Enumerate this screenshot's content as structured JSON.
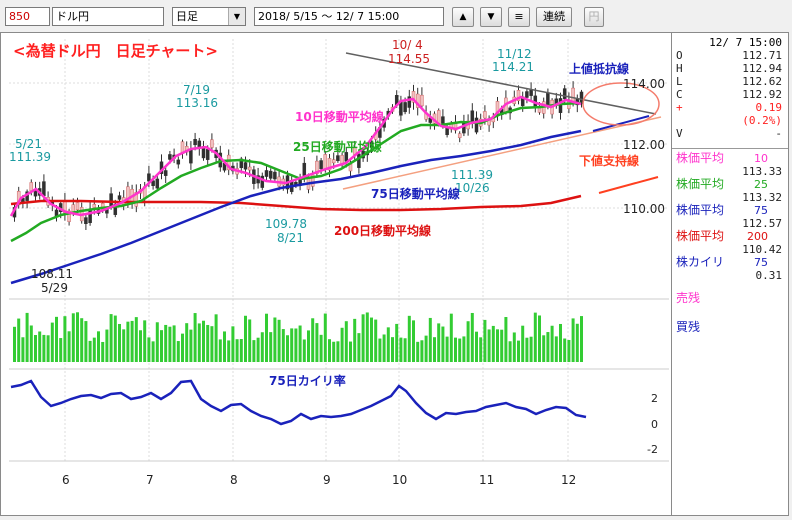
{
  "toolbar": {
    "code": "850",
    "pair": "ドル円",
    "period": "日足",
    "date_range": "2018/ 5/15 ～ 12/ 7 15:00",
    "up_icon": "triangle-up-icon",
    "down_icon": "triangle-down-icon",
    "menu_icon": "menu-lines-icon",
    "continuous_label": "連続",
    "yen_label": "円"
  },
  "chart": {
    "title": "<為替ドル円　日足チャート>",
    "y_ticks": [
      "114.00",
      "112.00",
      "110.00"
    ],
    "x_ticks": [
      "6",
      "7",
      "8",
      "9",
      "10",
      "11",
      "12"
    ],
    "osc_ticks": [
      "2",
      "0",
      "-2"
    ],
    "annotations": {
      "may21_date": "5/21",
      "may21_val": "111.39",
      "may29_val": "108.11",
      "may29_date": "5/29",
      "jul19_date": "7/19",
      "jul19_val": "113.16",
      "aug21_val": "109.78",
      "aug21_date": "8/21",
      "oct4_date": "10/ 4",
      "oct4_val": "114.55",
      "nov12_date": "11/12",
      "nov12_val": "114.21",
      "oct26_val": "111.39",
      "oct26_date": "10/26",
      "resistance": "上値抵抗線",
      "support": "下値支持線",
      "ma10": "10日移動平均線",
      "ma25": "25日移動平均線",
      "ma75": "75日移動平均線",
      "ma200": "200日移動平均線",
      "osc": "75日カイリ率"
    },
    "colors": {
      "up": "#f0c0c0",
      "down": "#303030",
      "ma10": "#ff33cc",
      "ma25": "#22aa22",
      "ma75": "#1a22bb",
      "ma200": "#dd1111",
      "volume": "#33cc33",
      "osc": "#1a22bb",
      "label_red": "#ff2020"
    }
  },
  "panel": {
    "datetime": "12/ 7 15:00",
    "ohlc": [
      {
        "k": "O",
        "v": "112.71"
      },
      {
        "k": "H",
        "v": "112.94"
      },
      {
        "k": "L",
        "v": "112.62"
      },
      {
        "k": "C",
        "v": "112.92"
      },
      {
        "k": "+",
        "v": "0.19"
      },
      {
        "k": "",
        "v": "(0.2%)"
      },
      {
        "k": "V",
        "v": "-"
      }
    ],
    "ma": [
      {
        "label": "株価平均",
        "period": "10",
        "value": "113.33",
        "color": "#ff33cc"
      },
      {
        "label": "株価平均",
        "period": "25",
        "value": "113.32",
        "color": "#22aa22"
      },
      {
        "label": "株価平均",
        "period": "75",
        "value": "112.57",
        "color": "#1a22bb"
      },
      {
        "label": "株価平均",
        "period": "200",
        "value": "110.42",
        "color": "#dd1111"
      },
      {
        "label": "株カイリ",
        "period": "75",
        "value": "0.31",
        "color": "#1a22bb"
      }
    ],
    "sell_label": "売残",
    "buy_label": "買残"
  }
}
